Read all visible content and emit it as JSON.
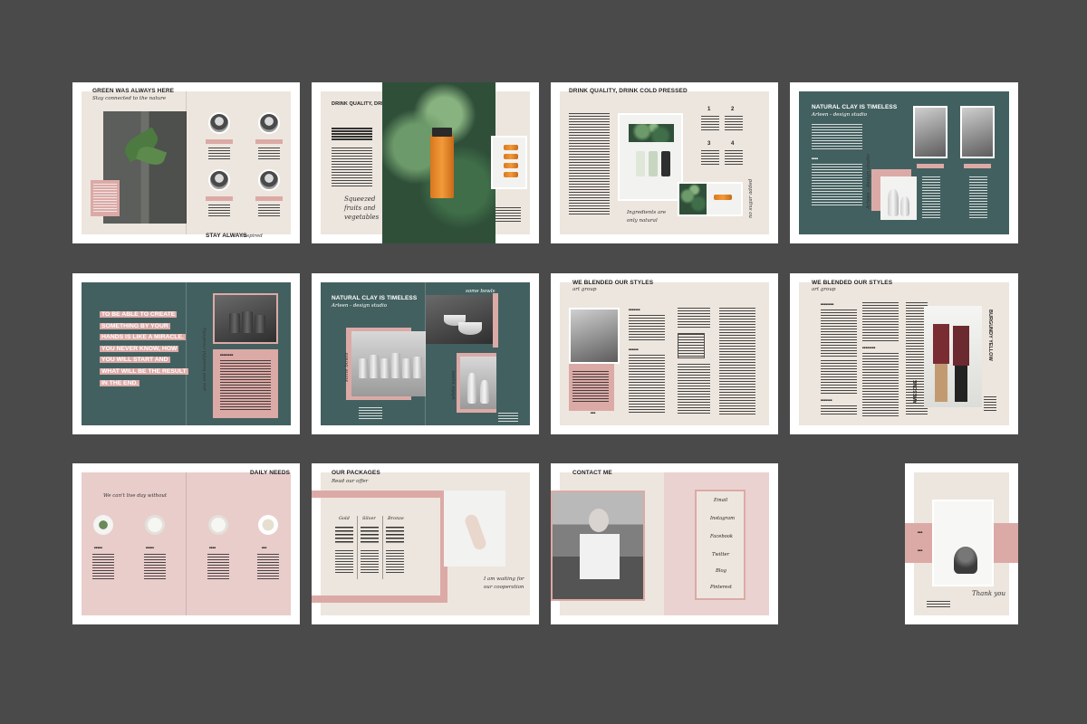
{
  "background": "#4a4a4a",
  "colors": {
    "beige": "#ede6de",
    "teal": "#436060",
    "pink": "#e9cdcb",
    "rose": "#dcaaa6"
  },
  "spread1": {
    "title": "GREEN WAS ALWAYS HERE",
    "subtitle": "Stay connected to the nature",
    "footer_title": "STAY ALWAYS",
    "footer_script": "inspired"
  },
  "spread2": {
    "title": "DRINK QUALITY, DRINK COLD PRESSED",
    "script_note": "Squeezed fruits and vegetables"
  },
  "spread3": {
    "title": "DRINK QUALITY, DRINK COLD PRESSED",
    "numbers": [
      "1",
      "2",
      "3",
      "4"
    ],
    "script_note": "Ingredients are only natural",
    "script_side": "no sugar added"
  },
  "spread4": {
    "title": "NATURAL CLAY IS TIMELESS",
    "subtitle": "Arleen - design studio"
  },
  "spread5": {
    "quote_lines": [
      "TO BE ABLE TO CREATE",
      "SOMETHING BY YOUR",
      "HANDS IS LIKE A MIRACLE.",
      "YOU NEVER KNOW, HOW",
      "YOU WILL START AND",
      "WHAT WILL BE THE RESULT",
      "IN THE END."
    ],
    "side_script": "you and beautiful creativity"
  },
  "spread6": {
    "title": "NATURAL CLAY IS TIMELESS",
    "subtitle": "Arleen - design studio",
    "script_a": "some bowls",
    "script_b": "white vases"
  },
  "spread7": {
    "title": "WE BLENDED OUR STYLES",
    "subtitle": "art group"
  },
  "spread8": {
    "title": "WE BLENDED OUR STYLES",
    "subtitle": "art group",
    "vertical_title": "BURGUNDY YELLOW",
    "vertical_title_b": "AWESOME"
  },
  "spread9": {
    "title": "DAILY NEEDS",
    "subtitle": "We can't live day without"
  },
  "spread10": {
    "title": "OUR PACKAGES",
    "subtitle": "Read our offer",
    "columns": [
      "Gold",
      "Silver",
      "Bronze"
    ],
    "script_note": "I am waiting for our cooperation"
  },
  "spread11": {
    "title": "CONTACT ME",
    "contacts": [
      "Email",
      "Instagram",
      "Facebook",
      "Twitter",
      "Blog",
      "Pinterest"
    ]
  },
  "spread12": {
    "script": "Thank you"
  }
}
